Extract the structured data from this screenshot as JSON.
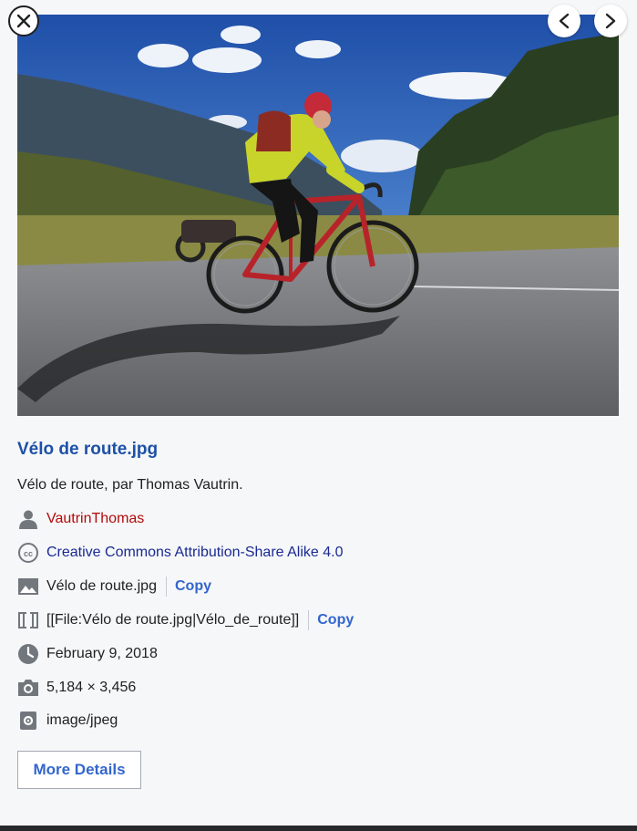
{
  "controls": {
    "close_icon": "close-icon",
    "prev_icon": "chevron-left-icon",
    "next_icon": "chevron-right-icon"
  },
  "image": {
    "subject": "Road cyclist in yellow jersey and red helmet riding a red road bike on a mountain road",
    "colors": {
      "sky": "#2f64b8",
      "road": "#76787c",
      "jersey": "#c9d42a",
      "bike": "#b8232a"
    }
  },
  "file": {
    "title": "Vélo de route.jpg",
    "description": "Vélo de route, par Thomas Vautrin.",
    "author": "VautrinThomas",
    "license": "Creative Commons Attribution-Share Alike 4.0",
    "filename": "Vélo de route.jpg",
    "wikitext": "[[File:Vélo de route.jpg|Vélo_de_route]]",
    "copy_label": "Copy",
    "date": "February 9, 2018",
    "dimensions": "5,184 × 3,456",
    "mime": "image/jpeg"
  },
  "actions": {
    "more_details_label": "More Details"
  },
  "colors": {
    "title": "#1d51a6",
    "author_link": "#b30a0a",
    "license_link": "#1a2a92",
    "copy": "#3366cc"
  }
}
